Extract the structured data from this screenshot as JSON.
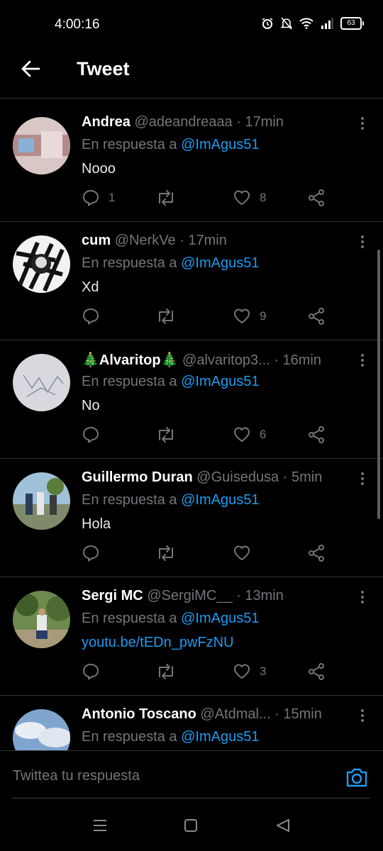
{
  "status_bar": {
    "time": "4:00:16",
    "battery": "63"
  },
  "header": {
    "title": "Tweet"
  },
  "reply_prefix": "En respuesta a",
  "tweets": [
    {
      "name": "Andrea",
      "handle": "@adeandreaaa",
      "time": "· 17min",
      "reply_to": "@ImAgus51",
      "text": "Nooo",
      "replies": "1",
      "likes": "8"
    },
    {
      "name": "cum",
      "handle": "@NerkVe",
      "time": "· 17min",
      "reply_to": "@ImAgus51",
      "text": "Xd",
      "replies": "",
      "likes": "9"
    },
    {
      "name": "🎄Alvaritop🎄",
      "handle": "@alvaritop3...",
      "time": "· 16min",
      "reply_to": "@ImAgus51",
      "text": "No",
      "replies": "",
      "likes": "6"
    },
    {
      "name": "Guillermo Duran",
      "handle": "@Guisedusa",
      "time": "· 5min",
      "reply_to": "@ImAgus51",
      "text": "Hola",
      "replies": "",
      "likes": ""
    },
    {
      "name": "Sergi MC",
      "handle": "@SergiMC__",
      "time": "· 13min",
      "reply_to": "@ImAgus51",
      "text": "youtu.be/tEDn_pwFzNU",
      "replies": "",
      "likes": "3"
    },
    {
      "name": "Antonio Toscano",
      "handle": "@Atdmal...",
      "time": "· 15min",
      "reply_to": "@ImAgus51",
      "text": "",
      "replies": "",
      "likes": ""
    }
  ],
  "compose": {
    "placeholder": "Twittea tu respuesta"
  },
  "colors": {
    "accent": "#1d9bf0",
    "background": "#000000",
    "muted": "#71767b"
  }
}
